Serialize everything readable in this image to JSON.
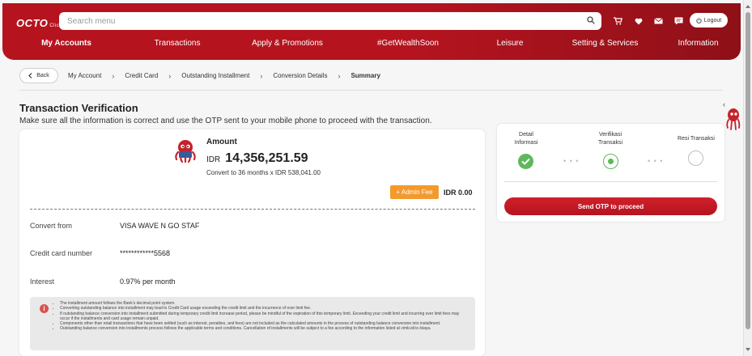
{
  "header": {
    "logo_text": "OCTO",
    "logo_sub": "Clicks",
    "search_placeholder": "Search menu",
    "logout_label": "Logout",
    "icons": [
      "cart-icon",
      "heart-icon",
      "mail-icon",
      "chat-icon"
    ]
  },
  "nav": {
    "items": [
      {
        "label": "My Accounts"
      },
      {
        "label": "Transactions"
      },
      {
        "label": "Apply & Promotions"
      },
      {
        "label": "#GetWealthSoon"
      },
      {
        "label": "Leisure"
      },
      {
        "label": "Setting & Services"
      },
      {
        "label": "Information"
      }
    ]
  },
  "breadcrumb": {
    "back_label": "Back",
    "items": [
      "My Account",
      "Credit Card",
      "Outstanding Installment",
      "Conversion Details",
      "Summary"
    ]
  },
  "page": {
    "title": "Transaction Verification",
    "subtitle": "Make sure all the information is correct and use the OTP sent to your mobile phone to proceed with the transaction."
  },
  "summary": {
    "amount_label": "Amount",
    "currency": "IDR",
    "amount": "14,356,251.59",
    "convert_note": "Convert to 36 months x IDR 538,041.00",
    "admin_fee_label": "+ Admin Fee",
    "admin_fee_value": "IDR 0.00",
    "rows": [
      {
        "label": "Convert from",
        "value": "VISA WAVE N GO STAF"
      },
      {
        "label": "Credit card number",
        "value": "************5568"
      },
      {
        "label": "Interest",
        "value": "0.97% per month"
      }
    ],
    "notice": [
      "The installment amount follows the Bank's decimal point system.",
      "Converting outstanding balance into installment may lead to Credit Card usage exceeding the credit limit and the incurrence of over limit fee.",
      "If outstanding balance conversion into installment submitted during temporary credit limit increase period, please be mindful of the expiration of this temporary limit. Exceeding your credit limit and incurring over limit fees may occur if the installments and card usage remain unpaid.",
      "Components other than retail transactions that have been settled (such as interest, penalties, and fees) are not included as the calculated amounts in the process of outstanding balance conversion into installment.",
      "Outstanding balance conversion into installments process follows the applicable terms and conditions. Cancellation of installments will be subject to a fee according to the information listed at cimb.id/cc-biaya."
    ]
  },
  "verification": {
    "steps": [
      {
        "label_line1": "Detail",
        "label_line2": "Informasi",
        "status": "done"
      },
      {
        "label_line1": "Verifikasi",
        "label_line2": "Transaksi",
        "status": "active"
      },
      {
        "label_line1": "Resi Transaksi",
        "label_line2": "",
        "status": "pending"
      }
    ],
    "otp_button_label": "Send OTP to proceed"
  },
  "colors": {
    "brand_red": "#b5141f",
    "admin_fee_orange": "#f39a2e",
    "step_green": "#5fb85b"
  }
}
